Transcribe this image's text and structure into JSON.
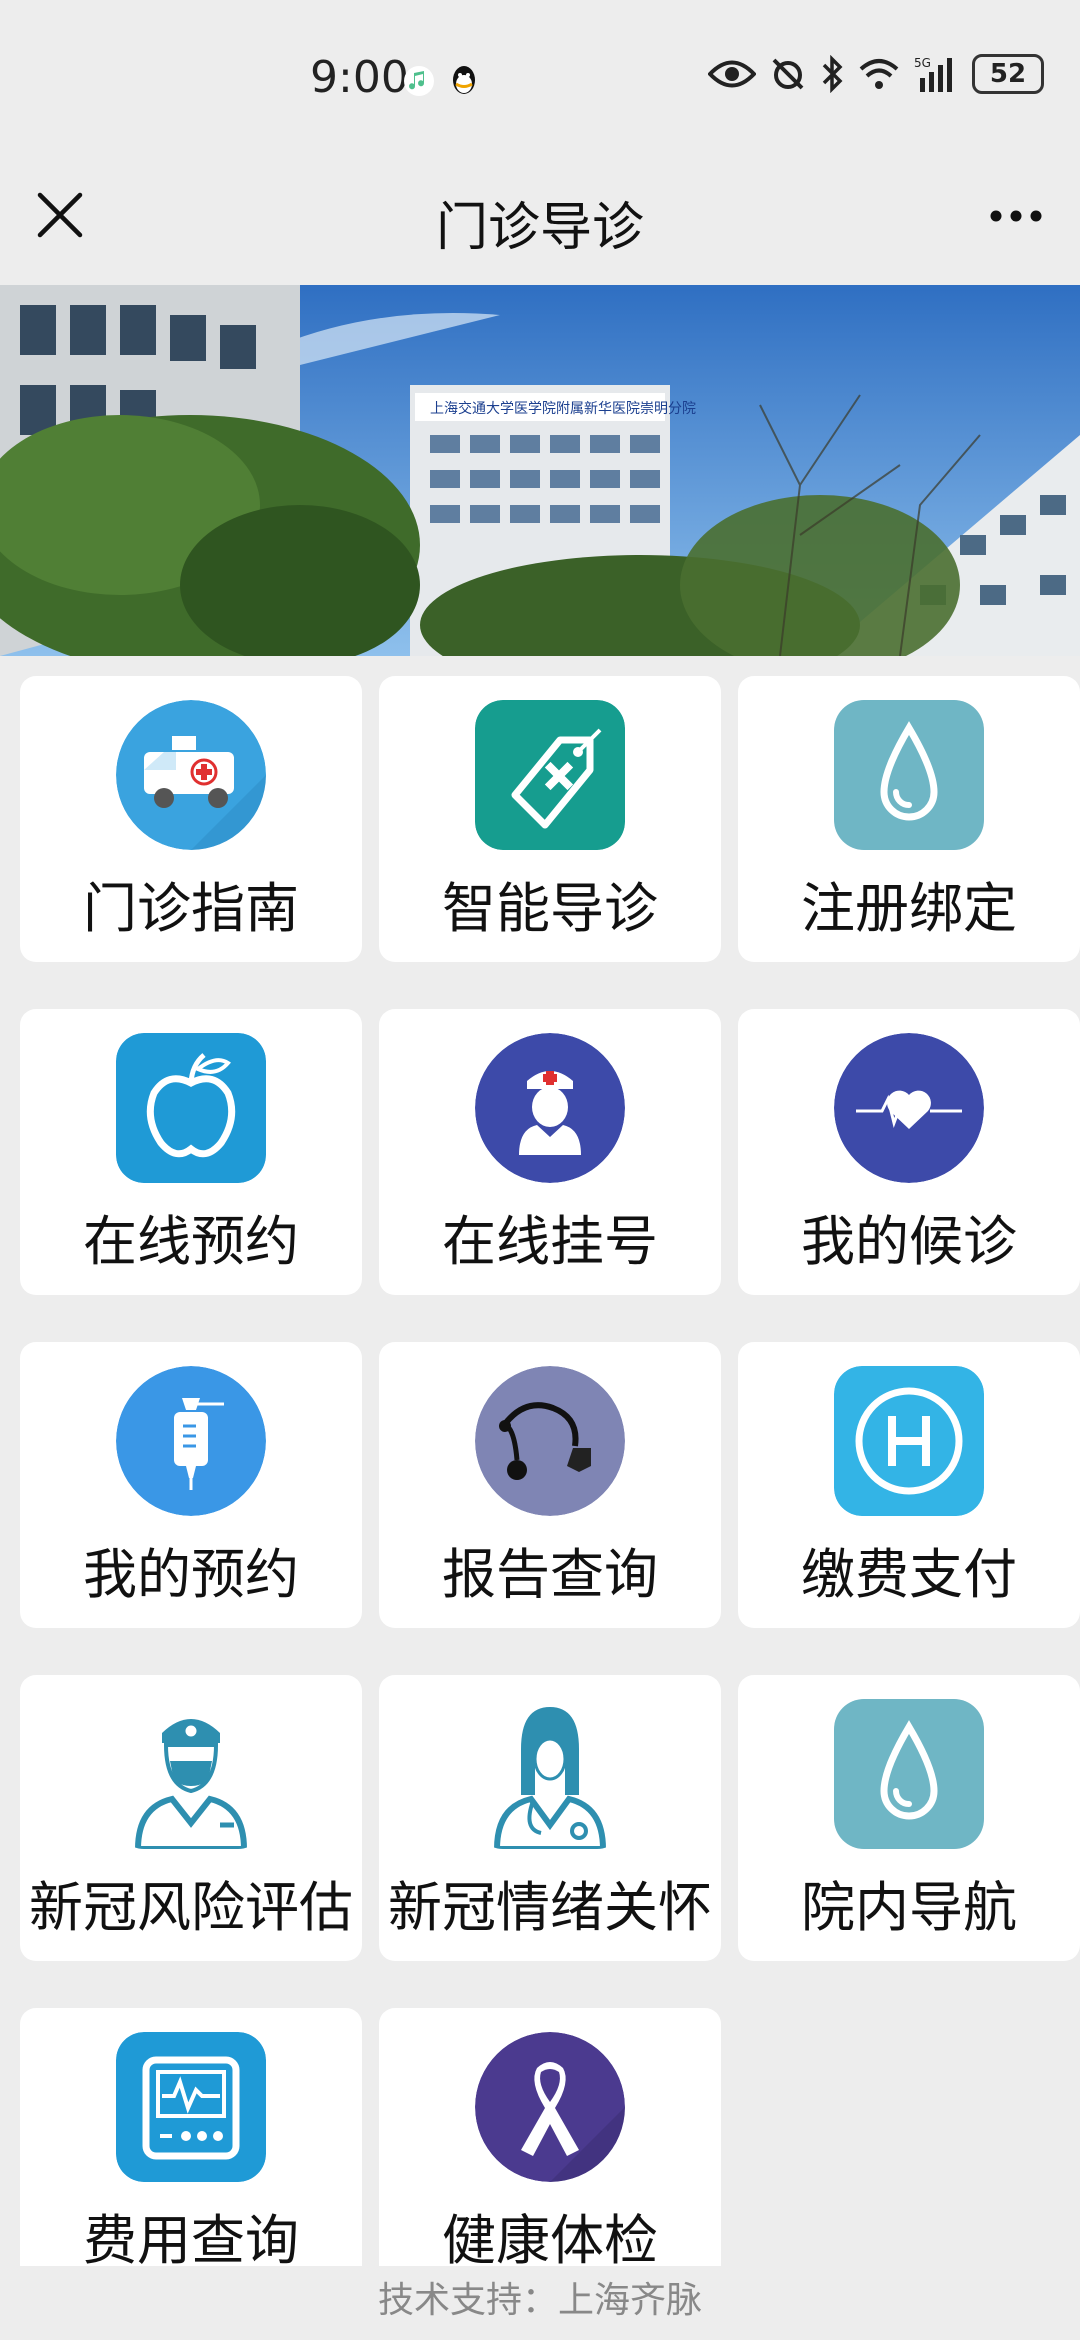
{
  "status_bar": {
    "time": "9:00",
    "battery": "52",
    "network": "5G"
  },
  "nav": {
    "title": "门诊导诊"
  },
  "banner": {
    "sign_text": "上海交通大学医学院附属新华医院崇明分院"
  },
  "tiles": [
    {
      "label": "门诊指南",
      "icon": "ambulance-icon",
      "color": "#3aa3df"
    },
    {
      "label": "智能导诊",
      "icon": "medical-tag-icon",
      "color": "#169d8f"
    },
    {
      "label": "注册绑定",
      "icon": "water-drop-icon",
      "color": "#6fb6c5"
    },
    {
      "label": "在线预约",
      "icon": "apple-icon",
      "color": "#1f9ad6"
    },
    {
      "label": "在线挂号",
      "icon": "nurse-icon",
      "color": "#3d4aa9"
    },
    {
      "label": "我的候诊",
      "icon": "heartbeat-icon",
      "color": "#3d4aa9"
    },
    {
      "label": "我的预约",
      "icon": "iv-drip-icon",
      "color": "#3a97e6"
    },
    {
      "label": "报告查询",
      "icon": "stethoscope-icon",
      "color": "#7f85b4"
    },
    {
      "label": "缴费支付",
      "icon": "hospital-h-icon",
      "color": "#33b4e6"
    },
    {
      "label": "新冠风险评估",
      "icon": "doctor-icon",
      "color": "#2e8fb0"
    },
    {
      "label": "新冠情绪关怀",
      "icon": "female-doctor-icon",
      "color": "#2e8fb0"
    },
    {
      "label": "院内导航",
      "icon": "water-drop-icon",
      "color": "#6fb6c5"
    },
    {
      "label": "费用查询",
      "icon": "monitor-icon",
      "color": "#1f9ad6"
    },
    {
      "label": "健康体检",
      "icon": "ribbon-icon",
      "color": "#4b3a8f"
    }
  ],
  "footer": {
    "text": "技术支持：上海齐脉"
  }
}
